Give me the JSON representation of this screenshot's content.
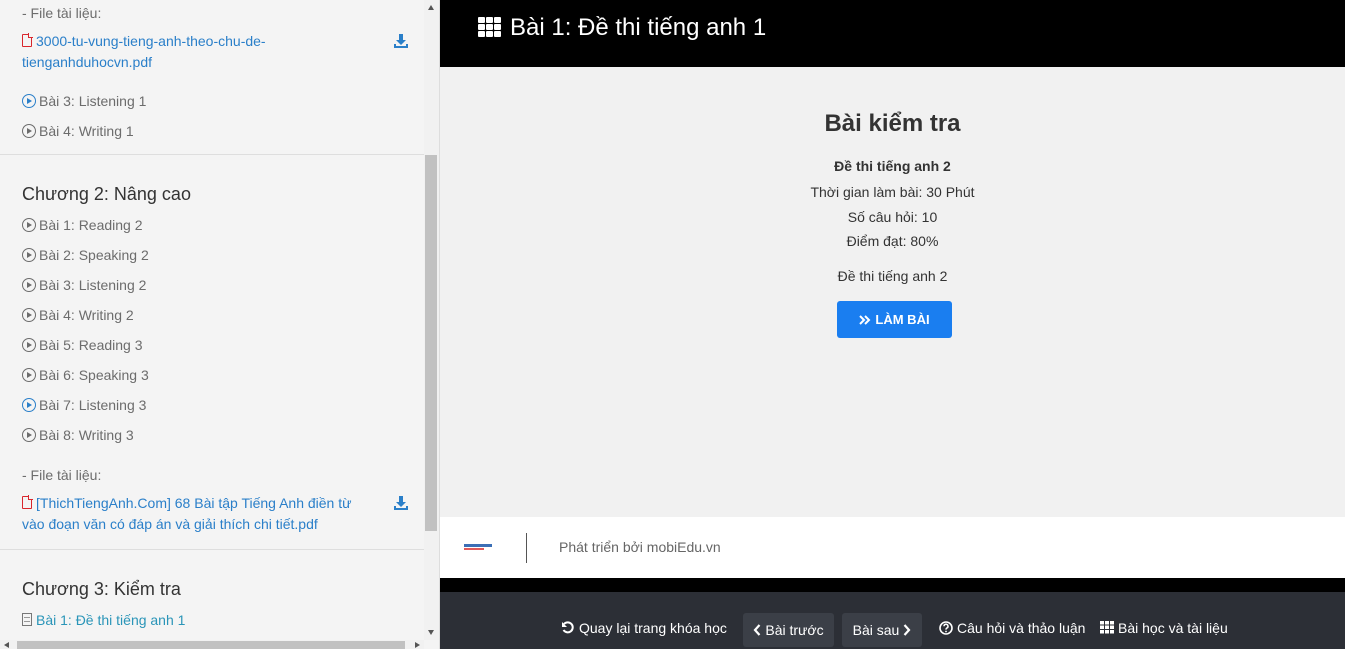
{
  "sidebar": {
    "file_label_1": "- File tài liệu:",
    "file_1": "3000-tu-vung-tieng-anh-theo-chu-de-tienganhduhocvn.pdf",
    "chapter1_tail": [
      {
        "label": "Bài 3: Listening 1",
        "icon": "play-circle-icon-blue"
      },
      {
        "label": "Bài 4: Writing 1",
        "icon": "play-circle-icon"
      }
    ],
    "chapter2": {
      "title": "Chương 2: Nâng cao",
      "lessons": [
        {
          "label": "Bài 1: Reading 2",
          "icon": "play-circle-icon"
        },
        {
          "label": "Bài 2: Speaking 2",
          "icon": "play-circle-icon"
        },
        {
          "label": "Bài 3: Listening 2",
          "icon": "play-circle-icon"
        },
        {
          "label": "Bài 4: Writing 2",
          "icon": "play-circle-icon"
        },
        {
          "label": "Bài 5: Reading 3",
          "icon": "play-circle-icon"
        },
        {
          "label": "Bài 6: Speaking 3",
          "icon": "play-circle-icon"
        },
        {
          "label": "Bài 7: Listening 3",
          "icon": "play-circle-icon-blue"
        },
        {
          "label": "Bài 8: Writing 3",
          "icon": "play-circle-icon"
        }
      ],
      "file_label": "- File tài liệu:",
      "file": "[ThichTiengAnh.Com] 68 Bài tập Tiếng Anh điền từ vào đoạn văn có đáp án và giải thích chi tiết.pdf"
    },
    "chapter3": {
      "title": "Chương 3: Kiểm tra",
      "lessons": [
        {
          "label": "Bài 1: Đề thi tiếng anh 1",
          "icon": "document-icon",
          "active": true
        }
      ]
    }
  },
  "header": {
    "title": "Bài 1: Đề thi tiếng anh 1",
    "icon": "grid-icon"
  },
  "quiz": {
    "heading": "Bài kiểm tra",
    "name": "Đề thi tiếng anh 2",
    "time": "Thời gian làm bài: 30 Phút",
    "questions": "Số câu hỏi: 10",
    "pass_score": "Điểm đạt: 80%",
    "description": "Đề thi tiếng anh 2",
    "start_label": "LÀM BÀI"
  },
  "footer": {
    "powered_by": "Phát triển bởi mobiEdu.vn"
  },
  "bottom_nav": {
    "back_label": "Quay lại trang khóa học",
    "prev_label": "Bài trước",
    "next_label": "Bài sau",
    "qa_label": "Câu hỏi và thảo luận",
    "materials_label": "Bài học và tài liệu"
  },
  "colors": {
    "link": "#2a7fc9",
    "active_lesson": "#2a95b8",
    "primary_button": "#1a7ef0",
    "topbar": "#000000",
    "bottombar": "#2c2f36"
  }
}
